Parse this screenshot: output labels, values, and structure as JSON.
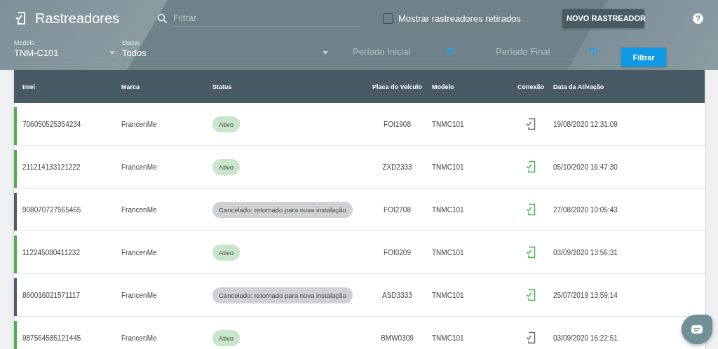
{
  "header": {
    "title": "Rastreadores",
    "search": {
      "placeholder": "Filtrar"
    },
    "show_retired": {
      "label": "Mostrar rastreadores retirados",
      "checked": false
    },
    "new_button": "NOVO RASTREADOR",
    "help": "?"
  },
  "filters": {
    "model": {
      "label": "Modelo",
      "value": "TNM-C101"
    },
    "status": {
      "label": "Status",
      "value": "Todos"
    },
    "start": {
      "placeholder": "Período Inicial"
    },
    "end": {
      "placeholder": "Período Final"
    },
    "button": "Filtrar"
  },
  "table": {
    "columns": [
      "Imei",
      "Marca",
      "Status",
      "Placa do Veículo",
      "Modelo",
      "Conexão",
      "Data da Ativação"
    ],
    "rows": [
      {
        "imei": "706050525354234",
        "brand": "FrancenMe",
        "status": "Ativo",
        "kind": "active",
        "plate": "FOI1908",
        "model": "TNMC101",
        "connected": false,
        "date": "19/08/2020 12:31:09"
      },
      {
        "imei": "211214133121222",
        "brand": "FrancenMe",
        "status": "Ativo",
        "kind": "active",
        "plate": "ZXD2333",
        "model": "TNMC101",
        "connected": true,
        "date": "05/10/2020 16:47:30"
      },
      {
        "imei": "908070727565465",
        "brand": "FrancenMe",
        "status": "Cancelado: retornado para nova instalação",
        "kind": "canceled",
        "plate": "FOI2708",
        "model": "TNMC101",
        "connected": true,
        "date": "27/08/2020 10:05:43"
      },
      {
        "imei": "112245080411232",
        "brand": "FrancenMe",
        "status": "Ativo",
        "kind": "active",
        "plate": "FOI0209",
        "model": "TNMC101",
        "connected": true,
        "date": "03/09/2020 13:56:31"
      },
      {
        "imei": "860016021571117",
        "brand": "FrancenMe",
        "status": "Cancelado: retornado para nova instalação",
        "kind": "canceled",
        "plate": "ASD3333",
        "model": "TNMC101",
        "connected": true,
        "date": "25/07/2019 13:59:14"
      },
      {
        "imei": "987564585121445",
        "brand": "FrancenMe",
        "status": "Ativo",
        "kind": "active",
        "plate": "BMW0309",
        "model": "TNMC101",
        "connected": false,
        "date": "03/09/2020 16:22:51"
      }
    ]
  }
}
